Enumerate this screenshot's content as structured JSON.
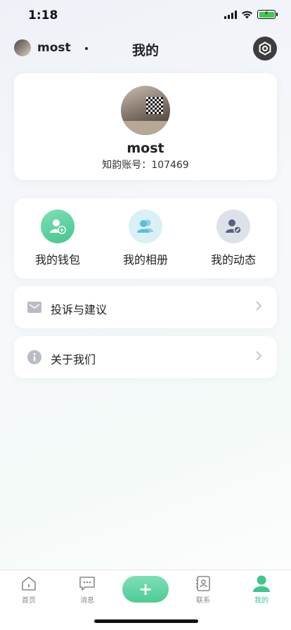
{
  "status_bar": {
    "time": "1:18"
  },
  "header": {
    "username": "most",
    "title": "我的"
  },
  "profile": {
    "name": "most",
    "account_id": "知韵账号：107469"
  },
  "quick_actions": [
    {
      "label": "我的钱包",
      "icon": "wallet-user-icon",
      "color": "#4ecb95"
    },
    {
      "label": "我的相册",
      "icon": "album-users-icon",
      "color": "#7cc8e0"
    },
    {
      "label": "我的动态",
      "icon": "activity-user-icon",
      "color": "#56637d"
    }
  ],
  "menu": [
    {
      "label": "投诉与建议",
      "icon": "mail-icon"
    },
    {
      "label": "关于我们",
      "icon": "info-icon"
    }
  ],
  "tabbar": {
    "tabs": [
      {
        "label": "首页",
        "icon": "home-icon"
      },
      {
        "label": "消息",
        "icon": "message-icon"
      },
      {
        "label": "联系",
        "icon": "contacts-icon"
      },
      {
        "label": "我的",
        "icon": "profile-icon",
        "active": true
      }
    ]
  },
  "colors": {
    "accent": "#3dc68d",
    "settings_bg": "#3d3d3d"
  }
}
